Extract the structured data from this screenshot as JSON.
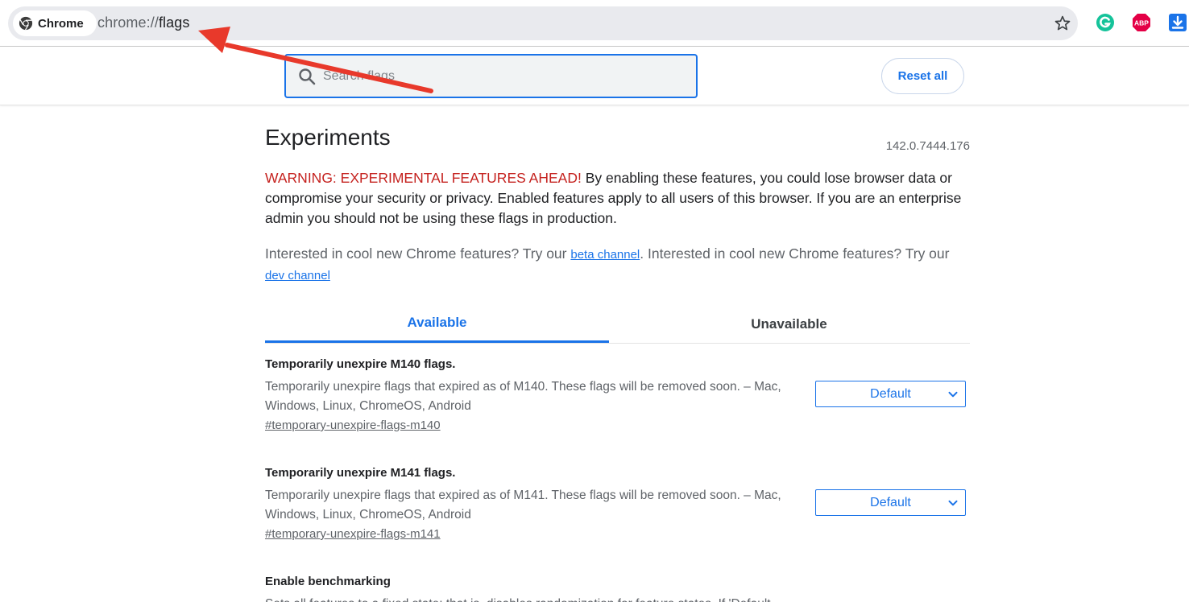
{
  "browser": {
    "chip_label": "Chrome",
    "url_scheme": "chrome://",
    "url_path": "flags",
    "extensions": [
      {
        "name": "grammarly-icon",
        "color": "#15c39a"
      },
      {
        "name": "abp-icon",
        "label": "ABP",
        "color": "#e40046"
      },
      {
        "name": "download-icon",
        "color": "#1a73e8"
      }
    ]
  },
  "header": {
    "search_placeholder": "Search flags",
    "reset_label": "Reset all"
  },
  "page": {
    "title": "Experiments",
    "version": "142.0.7444.176",
    "warning_red": "WARNING: EXPERIMENTAL FEATURES AHEAD!",
    "warning_rest": " By enabling these features, you could lose browser data or compromise your security or privacy. Enabled features apply to all users of this browser. If you are an enterprise admin you should not be using these flags in production.",
    "promo_text_1": "Interested in cool new Chrome features? Try our ",
    "promo_link_1": "beta channel",
    "promo_text_2": ". Interested in cool new Chrome features? Try our ",
    "promo_link_2": "dev channel"
  },
  "tabs": [
    {
      "label": "Available",
      "active": true
    },
    {
      "label": "Unavailable",
      "active": false
    }
  ],
  "flags": [
    {
      "name": "Temporarily unexpire M140 flags.",
      "description": "Temporarily unexpire flags that expired as of M140. These flags will be removed soon. – Mac, Windows, Linux, ChromeOS, Android",
      "link": "#temporary-unexpire-flags-m140",
      "value": "Default"
    },
    {
      "name": "Temporarily unexpire M141 flags.",
      "description": "Temporarily unexpire flags that expired as of M141. These flags will be removed soon. – Mac, Windows, Linux, ChromeOS, Android",
      "link": "#temporary-unexpire-flags-m141",
      "value": "Default"
    },
    {
      "name": "Enable benchmarking",
      "description": "Sets all features to a fixed state; that is, disables randomization for feature states. If 'Default"
    }
  ],
  "colors": {
    "accent": "#1a73e8",
    "warning": "#c5221f",
    "annotation_arrow": "#e8392b"
  }
}
